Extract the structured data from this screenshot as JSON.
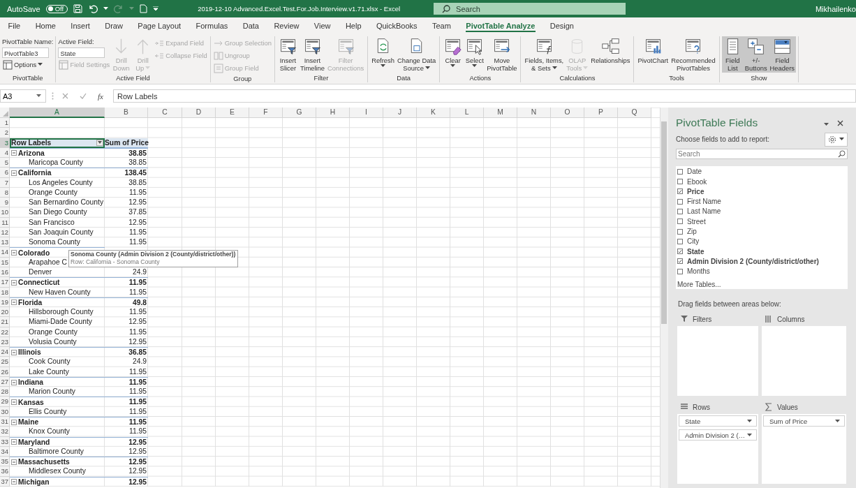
{
  "title_bar": {
    "autosave_label": "AutoSave",
    "autosave_state": "Off",
    "autosave_on": false,
    "title": "2019-12-10 Advanced.Excel.Test.For.Job.Interview.v1.71.xlsx  -  Excel",
    "search_placeholder": "Search",
    "user": "Mikhailenko"
  },
  "tabs": [
    {
      "label": "File",
      "selected": false
    },
    {
      "label": "Home",
      "selected": false
    },
    {
      "label": "Insert",
      "selected": false
    },
    {
      "label": "Draw",
      "selected": false
    },
    {
      "label": "Page Layout",
      "selected": false
    },
    {
      "label": "Formulas",
      "selected": false
    },
    {
      "label": "Data",
      "selected": false
    },
    {
      "label": "Review",
      "selected": false
    },
    {
      "label": "View",
      "selected": false
    },
    {
      "label": "Help",
      "selected": false
    },
    {
      "label": "QuickBooks",
      "selected": false
    },
    {
      "label": "Team",
      "selected": false
    },
    {
      "label": "PivotTable Analyze",
      "selected": true
    },
    {
      "label": "Design",
      "selected": false
    }
  ],
  "ribbon": {
    "groups": [
      {
        "label": "PivotTable",
        "columns": [
          {
            "kind": "stack",
            "items": [
              {
                "kind": "label",
                "text": "PivotTable Name:"
              },
              {
                "kind": "field",
                "value": "PivotTable3"
              },
              {
                "kind": "small",
                "label": "Options",
                "caret": true,
                "disabled": false
              }
            ]
          }
        ]
      },
      {
        "label": "Active Field",
        "columns": [
          {
            "kind": "stack",
            "items": [
              {
                "kind": "label",
                "text": "Active Field:"
              },
              {
                "kind": "field",
                "value": "State"
              },
              {
                "kind": "small",
                "label": "Field Settings",
                "caret": false,
                "disabled": true
              }
            ]
          },
          {
            "kind": "big",
            "lines": [
              "Drill",
              "Down"
            ],
            "caret": false,
            "disabled": true
          },
          {
            "kind": "big",
            "lines": [
              "Drill",
              "Up"
            ],
            "caret": true,
            "disabled": true
          },
          {
            "kind": "stack",
            "items": [
              {
                "kind": "small",
                "label": "Expand Field",
                "caret": false,
                "disabled": true
              },
              {
                "kind": "small",
                "label": "Collapse Field",
                "caret": false,
                "disabled": true
              }
            ]
          }
        ]
      },
      {
        "label": "Group",
        "columns": [
          {
            "kind": "stack",
            "items": [
              {
                "kind": "small",
                "label": "Group Selection",
                "caret": false,
                "disabled": true
              },
              {
                "kind": "small",
                "label": "Ungroup",
                "caret": false,
                "disabled": true
              },
              {
                "kind": "small",
                "label": "Group Field",
                "caret": false,
                "disabled": true
              }
            ]
          }
        ]
      },
      {
        "label": "Filter",
        "columns": [
          {
            "kind": "big",
            "lines": [
              "Insert",
              "Slicer"
            ],
            "caret": false,
            "disabled": false
          },
          {
            "kind": "big",
            "lines": [
              "Insert",
              "Timeline"
            ],
            "caret": false,
            "disabled": false
          },
          {
            "kind": "big",
            "lines": [
              "Filter",
              "Connections"
            ],
            "caret": false,
            "disabled": true
          }
        ]
      },
      {
        "label": "Data",
        "columns": [
          {
            "kind": "big",
            "lines": [
              "Refresh"
            ],
            "caret": true,
            "disabled": false
          },
          {
            "kind": "big",
            "lines": [
              "Change Data",
              "Source"
            ],
            "caret": true,
            "disabled": false
          }
        ]
      },
      {
        "label": "Actions",
        "columns": [
          {
            "kind": "big",
            "lines": [
              "Clear"
            ],
            "caret": true,
            "disabled": false
          },
          {
            "kind": "big",
            "lines": [
              "Select"
            ],
            "caret": true,
            "disabled": false
          },
          {
            "kind": "big",
            "lines": [
              "Move",
              "PivotTable"
            ],
            "caret": false,
            "disabled": false
          }
        ]
      },
      {
        "label": "Calculations",
        "columns": [
          {
            "kind": "big",
            "lines": [
              "Fields, Items,",
              "& Sets"
            ],
            "caret": true,
            "disabled": false
          },
          {
            "kind": "big",
            "lines": [
              "OLAP",
              "Tools"
            ],
            "caret": true,
            "disabled": true
          },
          {
            "kind": "big",
            "lines": [
              "Relationships"
            ],
            "caret": false,
            "disabled": false
          }
        ]
      },
      {
        "label": "Tools",
        "columns": [
          {
            "kind": "big",
            "lines": [
              "PivotChart"
            ],
            "caret": false,
            "disabled": false
          },
          {
            "kind": "big",
            "lines": [
              "Recommended",
              "PivotTables"
            ],
            "caret": false,
            "disabled": false
          }
        ]
      },
      {
        "label": "Show",
        "columns": [
          {
            "kind": "big",
            "lines": [
              "Field",
              "List"
            ],
            "caret": false,
            "disabled": false,
            "on": true
          },
          {
            "kind": "big",
            "lines": [
              "+/-",
              "Buttons"
            ],
            "caret": false,
            "disabled": false,
            "on": true
          },
          {
            "kind": "big",
            "lines": [
              "Field",
              "Headers"
            ],
            "caret": false,
            "disabled": false,
            "on": true
          }
        ]
      }
    ]
  },
  "formula_bar": {
    "name_box": "A3",
    "fx": "fx",
    "formula": "Row Labels"
  },
  "sheet": {
    "columns": [
      {
        "label": "A",
        "selected": true
      },
      {
        "label": "B",
        "selected": false
      },
      {
        "label": "C",
        "selected": false
      },
      {
        "label": "D",
        "selected": false
      },
      {
        "label": "E",
        "selected": false
      },
      {
        "label": "F",
        "selected": false
      },
      {
        "label": "G",
        "selected": false
      },
      {
        "label": "H",
        "selected": false
      },
      {
        "label": "I",
        "selected": false
      },
      {
        "label": "J",
        "selected": false
      },
      {
        "label": "K",
        "selected": false
      },
      {
        "label": "L",
        "selected": false
      },
      {
        "label": "M",
        "selected": false
      },
      {
        "label": "N",
        "selected": false
      },
      {
        "label": "O",
        "selected": false
      },
      {
        "label": "P",
        "selected": false
      },
      {
        "label": "Q",
        "selected": false
      }
    ],
    "rows": [
      {
        "row": "1",
        "kind": "blank"
      },
      {
        "row": "2",
        "kind": "blank"
      },
      {
        "row": "3",
        "kind": "header",
        "label": "Row Labels",
        "value": "Sum of Price"
      },
      {
        "row": "4",
        "kind": "state",
        "label": "Arizona",
        "value": "38.85",
        "expanded": true
      },
      {
        "row": "5",
        "kind": "county",
        "label": "Maricopa County",
        "value": "38.85"
      },
      {
        "row": "6",
        "kind": "state",
        "label": "California",
        "value": "138.45",
        "expanded": true
      },
      {
        "row": "7",
        "kind": "county",
        "label": "Los Angeles County",
        "value": "38.85"
      },
      {
        "row": "8",
        "kind": "county",
        "label": "Orange County",
        "value": "11.95"
      },
      {
        "row": "9",
        "kind": "county",
        "label": "San Bernardino County",
        "value": "12.95"
      },
      {
        "row": "10",
        "kind": "county",
        "label": "San Diego County",
        "value": "37.85"
      },
      {
        "row": "11",
        "kind": "county",
        "label": "San Francisco",
        "value": "12.95"
      },
      {
        "row": "12",
        "kind": "county",
        "label": "San Joaquin County",
        "value": "11.95"
      },
      {
        "row": "13",
        "kind": "county",
        "label": "Sonoma County",
        "value": "11.95"
      },
      {
        "row": "14",
        "kind": "state",
        "label": "Colorado",
        "expanded": true
      },
      {
        "row": "15",
        "kind": "county",
        "label": "Arapahoe C"
      },
      {
        "row": "16",
        "kind": "county",
        "label": "Denver",
        "value": "24.9"
      },
      {
        "row": "17",
        "kind": "state",
        "label": "Connecticut",
        "value": "11.95",
        "expanded": true
      },
      {
        "row": "18",
        "kind": "county",
        "label": "New Haven County",
        "value": "11.95"
      },
      {
        "row": "19",
        "kind": "state",
        "label": "Florida",
        "value": "49.8",
        "expanded": true
      },
      {
        "row": "20",
        "kind": "county",
        "label": "Hillsborough County",
        "value": "11.95"
      },
      {
        "row": "21",
        "kind": "county",
        "label": "Miami-Dade County",
        "value": "12.95"
      },
      {
        "row": "22",
        "kind": "county",
        "label": "Orange County",
        "value": "11.95"
      },
      {
        "row": "23",
        "kind": "county",
        "label": "Volusia County",
        "value": "12.95"
      },
      {
        "row": "24",
        "kind": "state",
        "label": "Illinois",
        "value": "36.85",
        "expanded": true
      },
      {
        "row": "25",
        "kind": "county",
        "label": "Cook County",
        "value": "24.9"
      },
      {
        "row": "26",
        "kind": "county",
        "label": "Lake County",
        "value": "11.95"
      },
      {
        "row": "27",
        "kind": "state",
        "label": "Indiana",
        "value": "11.95",
        "expanded": true
      },
      {
        "row": "28",
        "kind": "county",
        "label": "Marion County",
        "value": "11.95"
      },
      {
        "row": "29",
        "kind": "state",
        "label": "Kansas",
        "value": "11.95",
        "expanded": true
      },
      {
        "row": "30",
        "kind": "county",
        "label": "Ellis County",
        "value": "11.95"
      },
      {
        "row": "31",
        "kind": "state",
        "label": "Maine",
        "value": "11.95",
        "expanded": true
      },
      {
        "row": "32",
        "kind": "county",
        "label": "Knox County",
        "value": "11.95"
      },
      {
        "row": "33",
        "kind": "state",
        "label": "Maryland",
        "value": "12.95",
        "expanded": true
      },
      {
        "row": "34",
        "kind": "county",
        "label": "Baltimore County",
        "value": "12.95"
      },
      {
        "row": "35",
        "kind": "state",
        "label": "Massachusetts",
        "value": "12.95",
        "expanded": true
      },
      {
        "row": "36",
        "kind": "county",
        "label": "Middlesex County",
        "value": "12.95"
      },
      {
        "row": "37",
        "kind": "state",
        "label": "Michigan",
        "value": "12.95",
        "expanded": true
      }
    ],
    "tooltip": {
      "title": "Sonoma County (Admin Division 2 (County/district/other))",
      "detail": "Row: California - Sonoma County"
    }
  },
  "field_pane": {
    "title": "PivotTable Fields",
    "choose_label": "Choose fields to add to report:",
    "search_placeholder": "Search",
    "fields": [
      {
        "name": "Date",
        "checked": false
      },
      {
        "name": "Ebook",
        "checked": false
      },
      {
        "name": "Price",
        "checked": true
      },
      {
        "name": "First Name",
        "checked": false
      },
      {
        "name": "Last Name",
        "checked": false
      },
      {
        "name": "Street",
        "checked": false
      },
      {
        "name": "Zip",
        "checked": false
      },
      {
        "name": "City",
        "checked": false
      },
      {
        "name": "State",
        "checked": true
      },
      {
        "name": "Admin Division 2 (County/district/other)",
        "checked": true
      },
      {
        "name": "Months",
        "checked": false
      }
    ],
    "more_tables": "More Tables...",
    "drag_label": "Drag fields between areas below:",
    "areas": [
      {
        "kind": "filters",
        "label": "Filters"
      },
      {
        "kind": "columns",
        "label": "Columns"
      },
      {
        "kind": "rows",
        "label": "Rows",
        "items": [
          "State",
          "Admin Division 2 (…"
        ]
      },
      {
        "kind": "values",
        "label": "Values",
        "items": [
          "Sum of Price"
        ]
      }
    ]
  }
}
